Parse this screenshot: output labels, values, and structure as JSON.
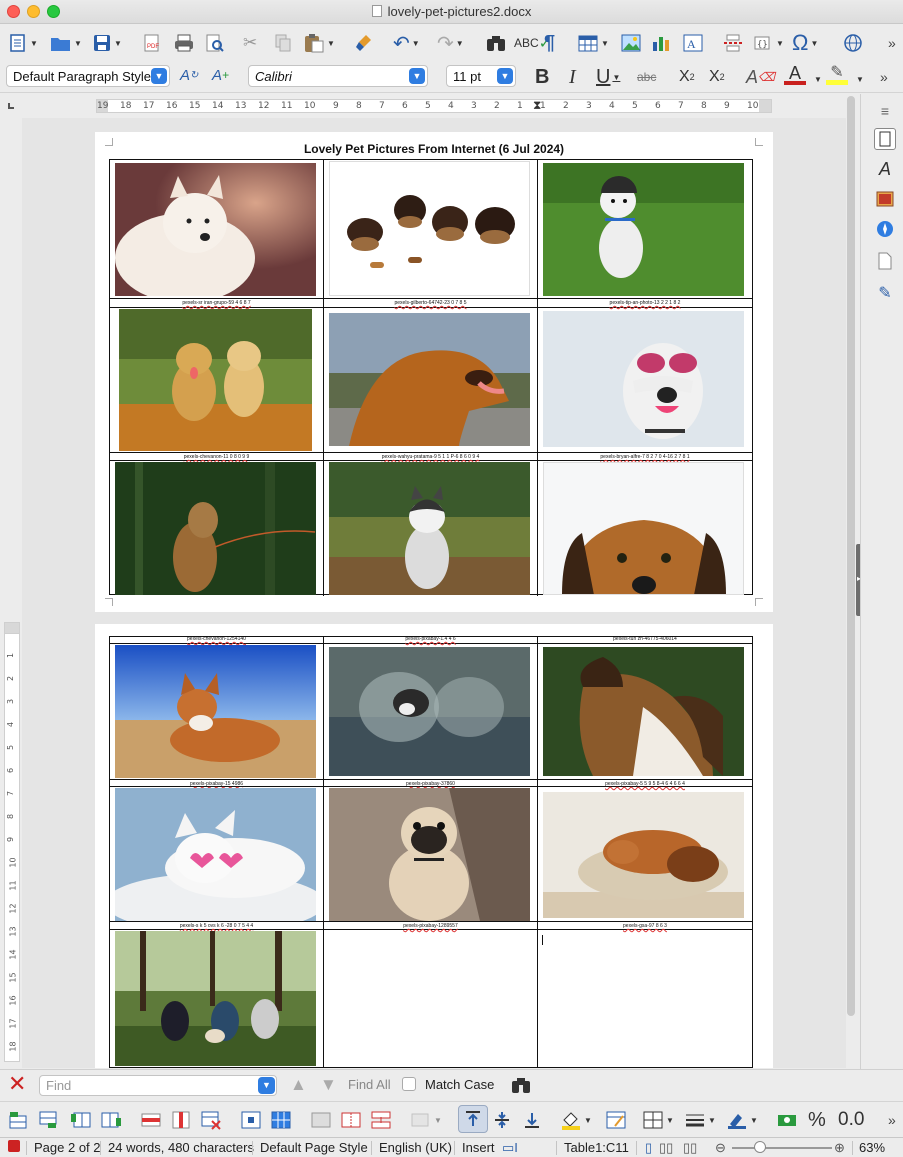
{
  "window": {
    "title": "lovely-pet-pictures2.docx"
  },
  "formatting": {
    "paragraph_style": "Default Paragraph Style",
    "font_name": "Calibri",
    "font_size": "11 pt"
  },
  "document": {
    "title": "Lovely Pet Pictures From Internet (6 Jul 2024)",
    "captions": [
      "pexels-chevanon-1254140",
      "pexels-pixabay-1.4 4 6",
      "pexels-tun zh-46775-406014",
      "pexels-pixabay-15 4986",
      "pexels-pixabay-37860",
      "pexels-pixabay-5 5 9 5 8-4 6 4 6 6 4",
      "pexels-s k 5 ovs k 6 -28 0 7 5 4 4",
      "pexels-pixabay-1289557",
      "pexels-gsa-97 8 6 3"
    ],
    "page1_captions": [
      "pexels-sr iran-grupo-59 4 6 8 7",
      "pexels-gilberto-64742-23 0 7 8 5",
      "pexels-tip-an-photo-13 2 2 1 8 2",
      "pexels-chevanon-11 0 8 0 9 9",
      "pexels-wahyu-pratama-9 5 1 1 P-6 8 6 0 9 4",
      "pexels-bryan-alfre-7 8 2 7 0 4-16 2 7 8 1"
    ]
  },
  "ruler": {
    "top_numbers": [
      "19",
      "18",
      "17",
      "16",
      "15",
      "14",
      "13",
      "12",
      "11",
      "10",
      "9",
      "8",
      "7",
      "6",
      "5",
      "4",
      "3",
      "2",
      "1",
      "1",
      "2",
      "3",
      "4",
      "5",
      "6",
      "7",
      "8",
      "9",
      "10"
    ],
    "left_numbers": [
      "1",
      "2",
      "3",
      "4",
      "5",
      "6",
      "7",
      "8",
      "9",
      "10",
      "11",
      "12",
      "13",
      "14",
      "15",
      "16",
      "17",
      "18"
    ]
  },
  "findbar": {
    "placeholder": "Find",
    "find_all": "Find All",
    "match_case": "Match Case"
  },
  "status": {
    "page": "Page 2 of 2",
    "words": "24 words, 480 characters",
    "page_style": "Default Page Style",
    "language": "English (UK)",
    "mode": "Insert",
    "cell": "Table1:C11",
    "zoom": "63%"
  },
  "colors": {
    "accent": "#2f7de1",
    "close": "#fe5f57",
    "minimize": "#febc2e",
    "maximize": "#28c840",
    "font_color": "#c9211e",
    "highlight": "#ffff38"
  }
}
